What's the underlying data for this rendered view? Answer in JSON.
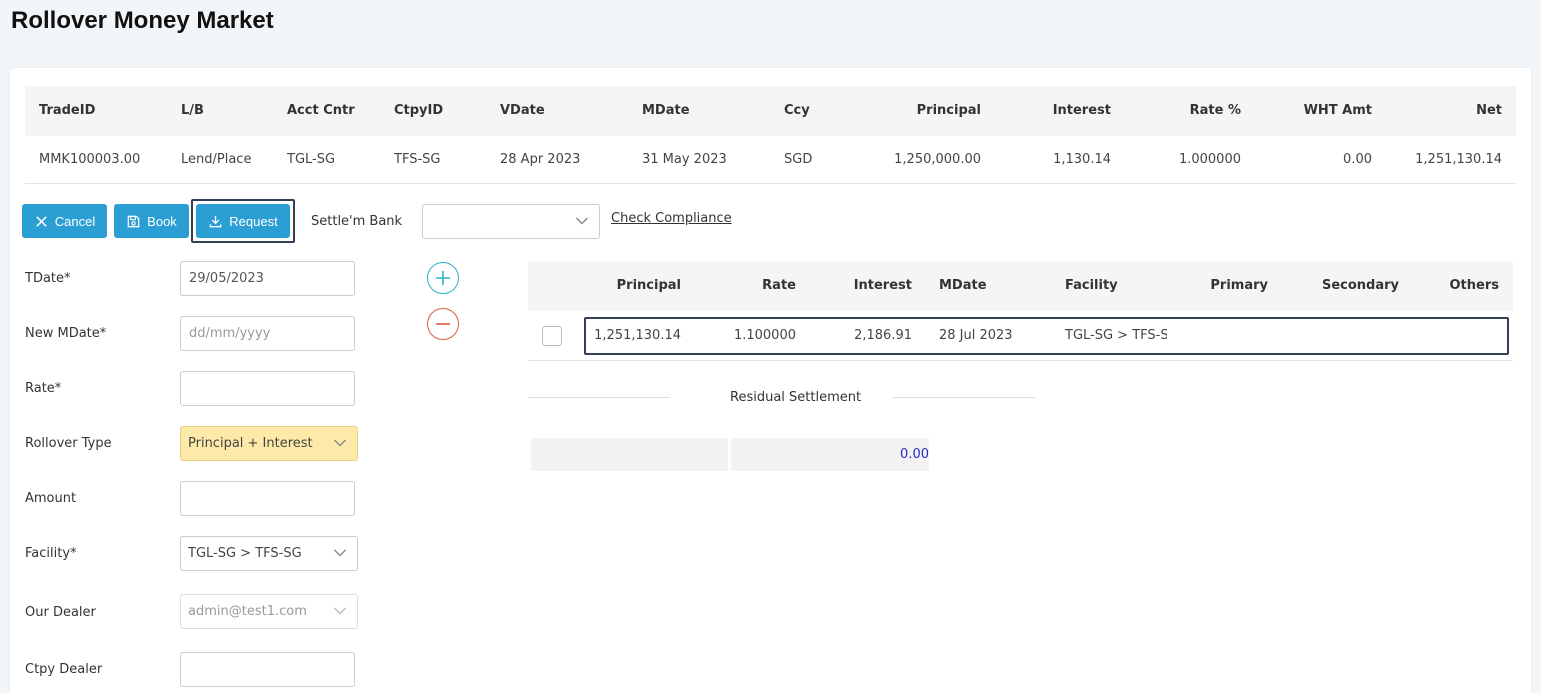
{
  "page": {
    "title": "Rollover Money Market"
  },
  "trade_table": {
    "headers": [
      "TradeID",
      "L/B",
      "Acct Cntr",
      "CtpyID",
      "VDate",
      "MDate",
      "Ccy",
      "Principal",
      "Interest",
      "Rate %",
      "WHT Amt",
      "Net"
    ],
    "row": [
      "MMK100003.00",
      "Lend/Place",
      "TGL-SG",
      "TFS-SG",
      "28 Apr 2023",
      "31 May 2023",
      "SGD",
      "1,250,000.00",
      "1,130.14",
      "1.000000",
      "0.00",
      "1,251,130.14"
    ]
  },
  "toolbar": {
    "cancel_label": "Cancel",
    "book_label": "Book",
    "request_label": "Request",
    "settle_bank_label": "Settle'm Bank",
    "settle_bank_value": "",
    "check_compliance_label": "Check Compliance"
  },
  "form": {
    "tdate_label": "TDate*",
    "tdate_value": "29/05/2023",
    "new_mdate_label": "New MDate*",
    "new_mdate_placeholder": "dd/mm/yyyy",
    "rate_label": "Rate*",
    "rate_value": "",
    "rollover_type_label": "Rollover Type",
    "rollover_type_value": "Principal + Interest",
    "amount_label": "Amount",
    "amount_value": "",
    "facility_label": "Facility*",
    "facility_value": "TGL-SG > TFS-SG",
    "our_dealer_label": "Our Dealer",
    "our_dealer_value": "admin@test1.com",
    "ctpy_dealer_label": "Ctpy Dealer",
    "ctpy_dealer_value": ""
  },
  "rollover_table": {
    "headers": [
      "Principal",
      "Rate",
      "Interest",
      "MDate",
      "Facility",
      "Primary",
      "Secondary",
      "Others"
    ],
    "row": [
      "1,251,130.14",
      "1.100000",
      "2,186.91",
      "28 Jul 2023",
      "TGL-SG > TFS-S(",
      "",
      "",
      ""
    ]
  },
  "residual": {
    "label": "Residual Settlement",
    "value": "0.00"
  },
  "colors": {
    "primary_button": "#2b9fd4",
    "highlight_select": "#fde9a8",
    "add_icon": "#2eb2c8",
    "remove_icon": "#e05a42",
    "residual_value": "#2a2ac8"
  }
}
